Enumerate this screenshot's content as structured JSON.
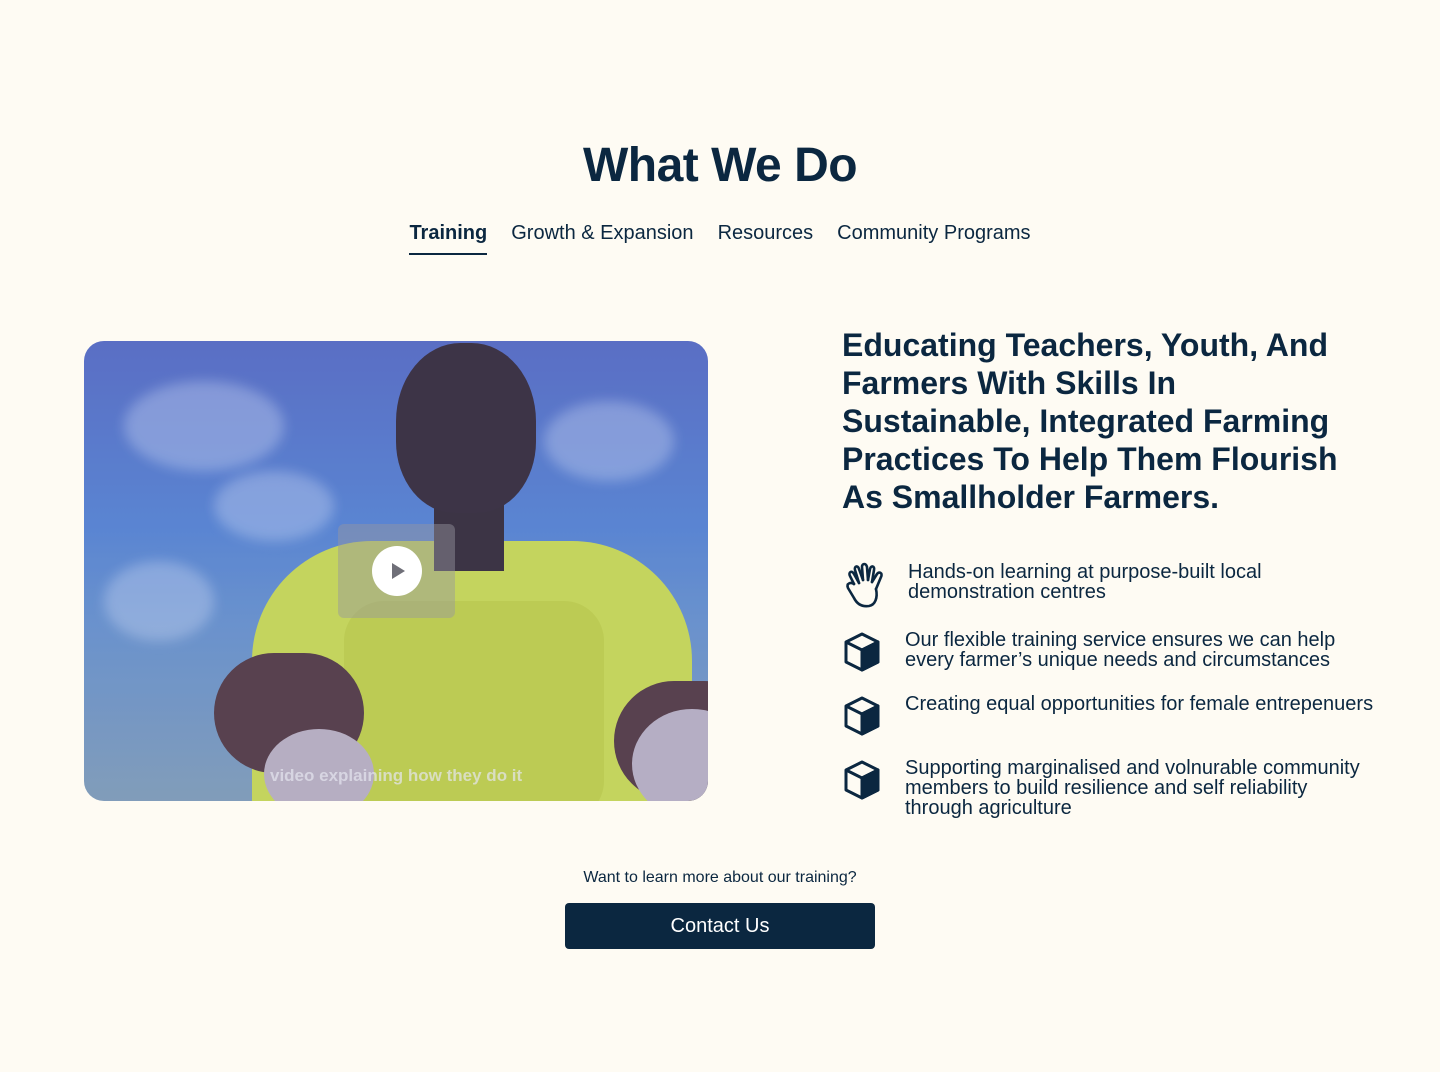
{
  "section": {
    "title": "What We Do"
  },
  "tabs": [
    {
      "label": "Training",
      "active": true
    },
    {
      "label": "Growth & Expansion",
      "active": false
    },
    {
      "label": "Resources",
      "active": false
    },
    {
      "label": "Community Programs",
      "active": false
    }
  ],
  "video": {
    "caption": "video explaining how they do it",
    "play_icon": "play-icon"
  },
  "content": {
    "heading": "Educating Teachers, Youth,  And Farmers With Skills In Sustainable, Integrated Farming Practices To Help Them Flourish As Smallholder Farmers.",
    "features": [
      {
        "icon": "hand-icon",
        "text": "Hands-on learning at purpose-built local demonstration centres"
      },
      {
        "icon": "cube-icon",
        "text": "Our flexible training service ensures we can help every farmer’s unique needs and circumstances"
      },
      {
        "icon": "cube-icon",
        "text": "Creating equal opportunities for female entrepenuers"
      },
      {
        "icon": "cube-icon",
        "text": "Supporting marginalised and volnurable community members to build resilience and self reliability through agriculture"
      }
    ]
  },
  "cta": {
    "prompt": "Want to learn more about our training?",
    "button_label": "Contact Us"
  },
  "colors": {
    "background": "#fefbf3",
    "primary": "#0b2740",
    "button_text": "#ffffff"
  }
}
